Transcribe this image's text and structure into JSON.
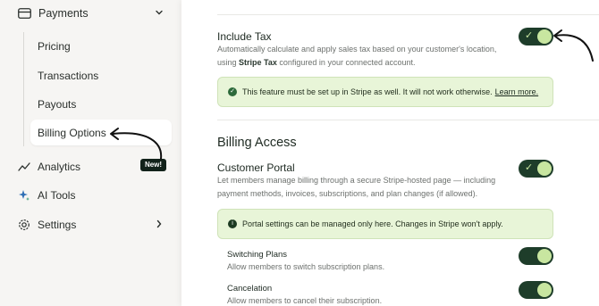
{
  "sidebar": {
    "payments": {
      "label": "Payments"
    },
    "sub_items": [
      {
        "label": "Pricing"
      },
      {
        "label": "Transactions"
      },
      {
        "label": "Payouts"
      },
      {
        "label": "Billing Options"
      }
    ],
    "analytics": {
      "label": "Analytics",
      "badge": "New!"
    },
    "ai_tools": {
      "label": "AI Tools"
    },
    "settings": {
      "label": "Settings"
    }
  },
  "main": {
    "include_tax": {
      "title": "Include Tax",
      "desc_before": "Automatically calculate and apply sales tax based on your customer's location,",
      "desc_using": "using",
      "desc_bold": "Stripe Tax",
      "desc_after": "configured in your connected account.",
      "enabled": true,
      "banner_text": "This feature must be set up in Stripe as well. It will not work otherwise.",
      "banner_link": "Learn more."
    },
    "billing_access": {
      "section_title": "Billing Access",
      "customer_portal": {
        "title": "Customer Portal",
        "desc_line1": "Let members manage billing through a secure Stripe-hosted page — including",
        "desc_line2": "payment methods, invoices, subscriptions, and plan changes (if allowed).",
        "enabled": true
      },
      "banner_text": "Portal settings can be managed only here. Changes in Stripe won't apply.",
      "switching_plans": {
        "title": "Switching Plans",
        "desc": "Allow members to switch subscription plans.",
        "enabled": true
      },
      "cancelation": {
        "title": "Cancelation",
        "desc": "Allow members to cancel their subscription.",
        "enabled": true
      }
    }
  },
  "colors": {
    "toggle_on": "#1e3d2a",
    "toggle_knob": "#c8e6a0",
    "banner_bg": "#e8f5d8",
    "badge_bg": "#12221a"
  }
}
